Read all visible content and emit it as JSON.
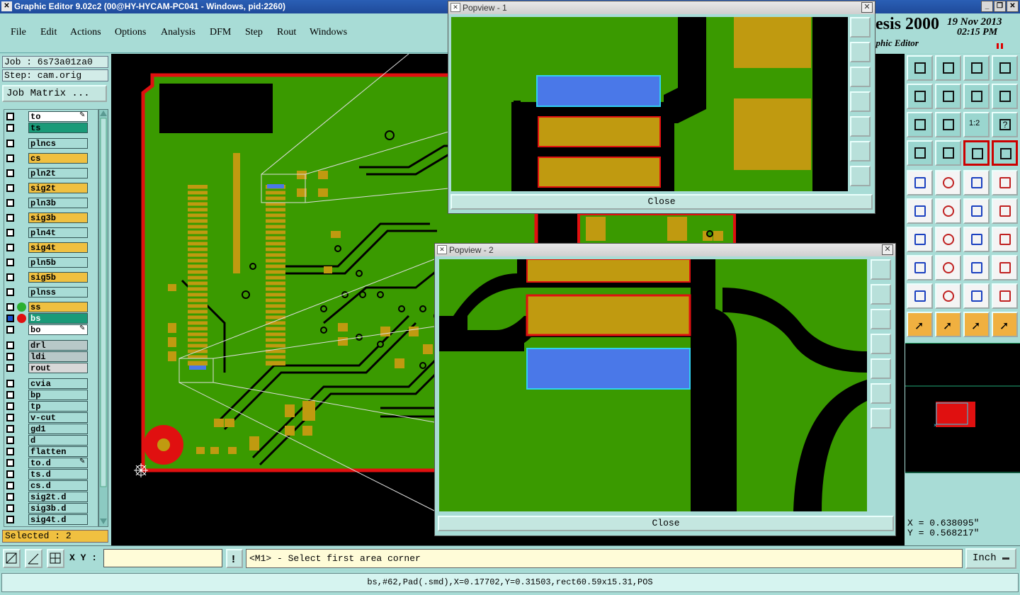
{
  "window": {
    "title": "Graphic Editor 9.02c2 (00@HY-HYCAM-PC041 - Windows, pid:2260)"
  },
  "menu": [
    "File",
    "Edit",
    "Actions",
    "Options",
    "Analysis",
    "DFM",
    "Step",
    "Rout",
    "Windows"
  ],
  "brand": {
    "name": "esis 2000",
    "date": "19 Nov 2013",
    "time": "02:15 PM",
    "subtitle": "aphic Editor"
  },
  "job": {
    "job_label": "Job : 6s73a01za0",
    "step_label": "Step: cam.orig",
    "matrix_button": "Job Matrix ..."
  },
  "layers": [
    {
      "name": "to",
      "color": "#ffffff",
      "edit": true
    },
    {
      "name": "ts",
      "color": "#1a9a78"
    },
    {
      "name": "plncs",
      "color": "#a8dcd6"
    },
    {
      "name": "cs",
      "color": "#f0c040"
    },
    {
      "name": "pln2t",
      "color": "#a8dcd6"
    },
    {
      "name": "sig2t",
      "color": "#f0c040"
    },
    {
      "name": "pln3b",
      "color": "#a8dcd6"
    },
    {
      "name": "sig3b",
      "color": "#f0c040"
    },
    {
      "name": "pln4t",
      "color": "#a8dcd6"
    },
    {
      "name": "sig4t",
      "color": "#f0c040"
    },
    {
      "name": "pln5b",
      "color": "#a8dcd6"
    },
    {
      "name": "sig5b",
      "color": "#f0c040"
    },
    {
      "name": "plnss",
      "color": "#a8dcd6"
    },
    {
      "name": "ss",
      "color": "#f0c040"
    },
    {
      "name": "bs",
      "color": "#1a9a78",
      "active": true
    },
    {
      "name": "bo",
      "color": "#ffffff",
      "edit": true
    },
    {
      "name": "drl",
      "color": "#b8c8c8"
    },
    {
      "name": "ldi",
      "color": "#b8c8c8"
    },
    {
      "name": "rout",
      "color": "#d8d8d8"
    },
    {
      "name": "cvia",
      "color": "#a8dcd6"
    },
    {
      "name": "bp",
      "color": "#a8dcd6"
    },
    {
      "name": "tp",
      "color": "#a8dcd6"
    },
    {
      "name": "v-cut",
      "color": "#a8dcd6"
    },
    {
      "name": "gd1",
      "color": "#a8dcd6"
    },
    {
      "name": "d",
      "color": "#a8dcd6"
    },
    {
      "name": "flatten",
      "color": "#a8dcd6"
    },
    {
      "name": "to.d",
      "color": "#a8dcd6",
      "edit": true
    },
    {
      "name": "ts.d",
      "color": "#a8dcd6"
    },
    {
      "name": "cs.d",
      "color": "#a8dcd6"
    },
    {
      "name": "sig2t.d",
      "color": "#a8dcd6"
    },
    {
      "name": "sig3b.d",
      "color": "#a8dcd6"
    },
    {
      "name": "sig4t.d",
      "color": "#a8dcd6"
    }
  ],
  "selected_label": "Selected : 2",
  "popview1": {
    "title": "Popview - 1",
    "close_label": "Close"
  },
  "popview2": {
    "title": "Popview - 2",
    "close_label": "Close"
  },
  "coordinates": {
    "x": "X = 0.638095\"",
    "y": "Y = 0.568217\""
  },
  "command": {
    "xy_label": "X Y :",
    "xy_value": "",
    "prompt": "<M1> - Select first area corner",
    "units": "Inch"
  },
  "status": "bs,#62,Pad(.smd),X=0.17702,Y=0.31503,rect60.59x15.31,POS",
  "colors": {
    "board": "#3a9a00",
    "copper": "#c09a10",
    "selected": "#4a78e8",
    "outline": "#e01010",
    "panel": "#a8dcd6"
  }
}
